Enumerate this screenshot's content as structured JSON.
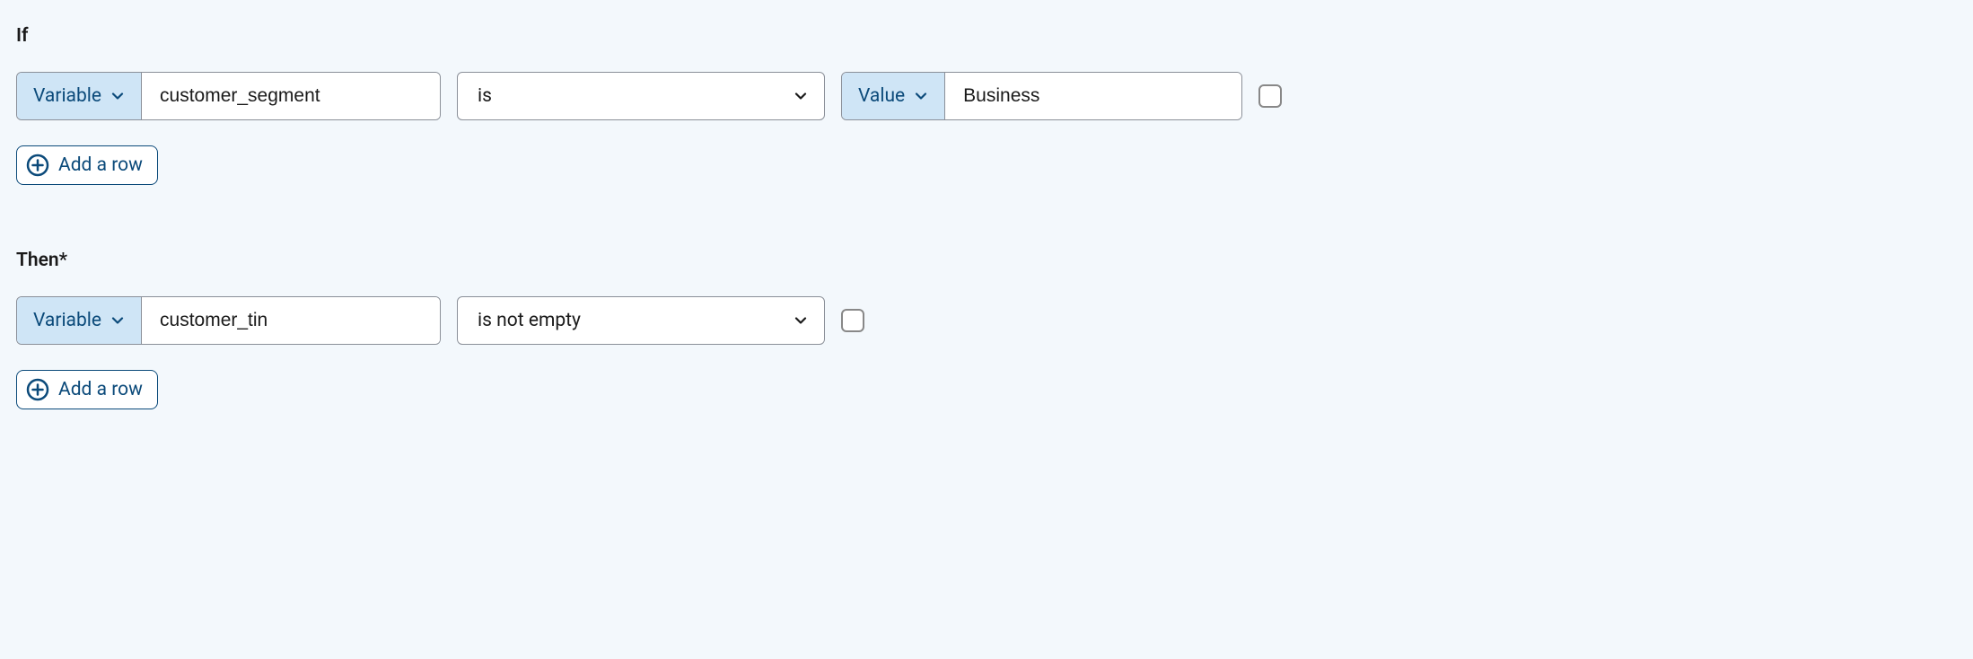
{
  "if": {
    "label": "If",
    "row": {
      "lhs_type": "Variable",
      "lhs_value": "customer_segment",
      "operator": "is",
      "rhs_type": "Value",
      "rhs_value": "Business"
    },
    "add_row_label": "Add a row"
  },
  "then": {
    "label": "Then*",
    "row": {
      "lhs_type": "Variable",
      "lhs_value": "customer_tin",
      "operator": "is not empty"
    },
    "add_row_label": "Add a row"
  }
}
